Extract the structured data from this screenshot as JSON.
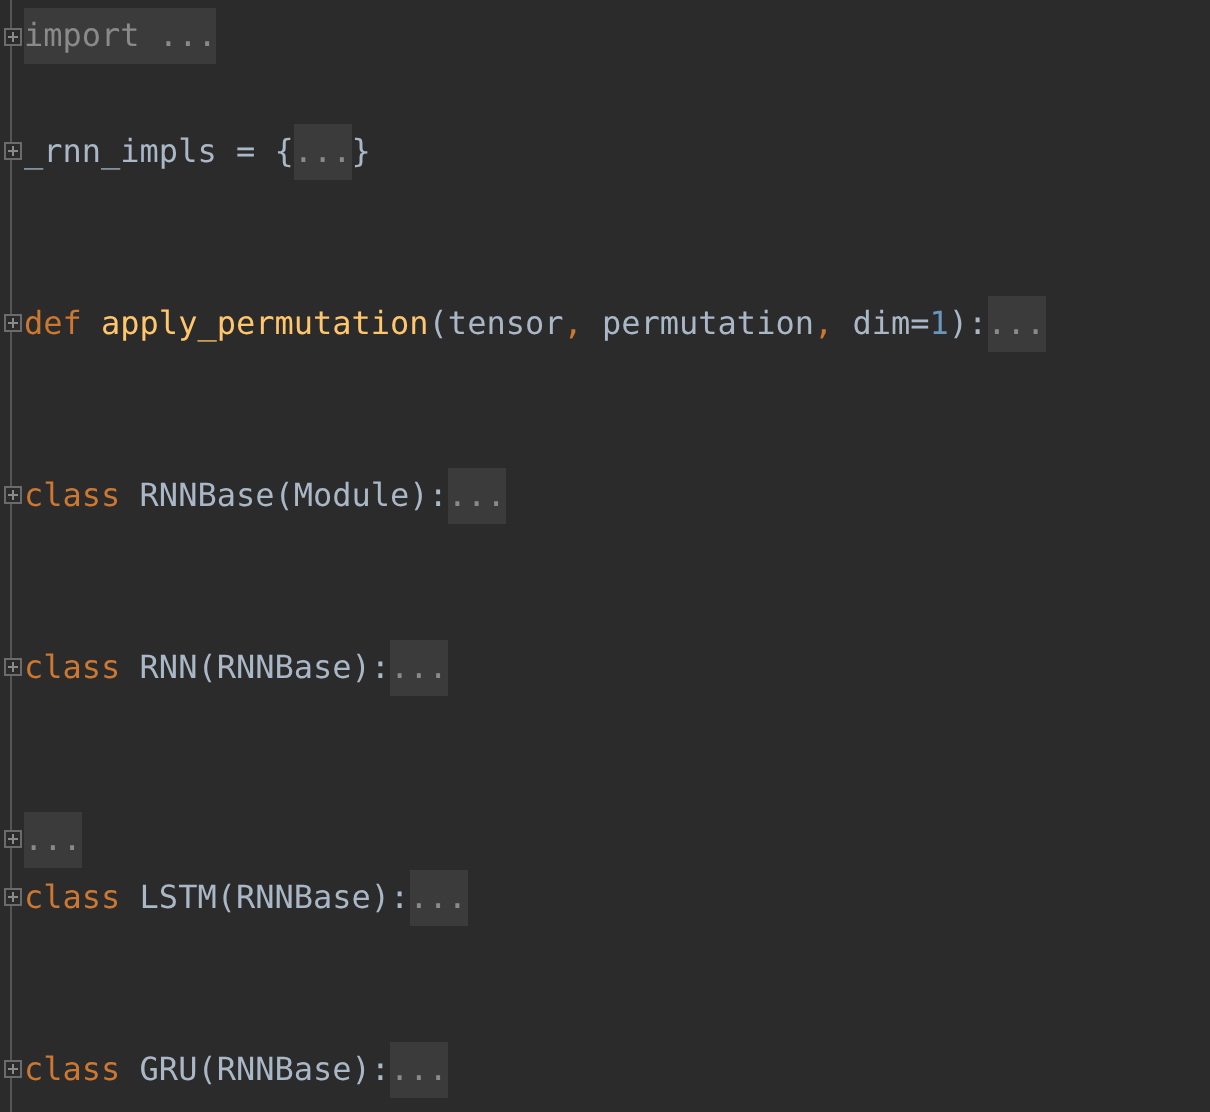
{
  "editor": {
    "lines": [
      {
        "kind": "code",
        "foldable": true,
        "tokens": [
          {
            "kind": "folded",
            "text": "import ..."
          }
        ]
      },
      {
        "kind": "blank"
      },
      {
        "kind": "code",
        "foldable": true,
        "tokens": [
          {
            "kind": "text",
            "text": "_rnn_impls = {"
          },
          {
            "kind": "folded",
            "text": "..."
          },
          {
            "kind": "text",
            "text": "}"
          }
        ]
      },
      {
        "kind": "blank"
      },
      {
        "kind": "blank"
      },
      {
        "kind": "code",
        "foldable": true,
        "tokens": [
          {
            "kind": "keyword",
            "text": "def "
          },
          {
            "kind": "function",
            "text": "apply_permutation"
          },
          {
            "kind": "text",
            "text": "(tensor"
          },
          {
            "kind": "punct",
            "text": ", "
          },
          {
            "kind": "text",
            "text": "permutation"
          },
          {
            "kind": "punct",
            "text": ", "
          },
          {
            "kind": "text",
            "text": "dim="
          },
          {
            "kind": "number",
            "text": "1"
          },
          {
            "kind": "text",
            "text": "):"
          },
          {
            "kind": "folded",
            "text": "..."
          }
        ]
      },
      {
        "kind": "blank"
      },
      {
        "kind": "blank"
      },
      {
        "kind": "code",
        "foldable": true,
        "tokens": [
          {
            "kind": "keyword",
            "text": "class "
          },
          {
            "kind": "text",
            "text": "RNNBase(Module):"
          },
          {
            "kind": "folded",
            "text": "..."
          }
        ]
      },
      {
        "kind": "blank"
      },
      {
        "kind": "blank"
      },
      {
        "kind": "code",
        "foldable": true,
        "tokens": [
          {
            "kind": "keyword",
            "text": "class "
          },
          {
            "kind": "text",
            "text": "RNN(RNNBase):"
          },
          {
            "kind": "folded",
            "text": "..."
          }
        ]
      },
      {
        "kind": "blank"
      },
      {
        "kind": "blank"
      },
      {
        "kind": "code",
        "foldable": true,
        "tokens": [
          {
            "kind": "folded",
            "text": "..."
          }
        ]
      },
      {
        "kind": "code",
        "foldable": true,
        "tokens": [
          {
            "kind": "keyword",
            "text": "class "
          },
          {
            "kind": "text",
            "text": "LSTM(RNNBase):"
          },
          {
            "kind": "folded",
            "text": "..."
          }
        ]
      },
      {
        "kind": "blank"
      },
      {
        "kind": "blank"
      },
      {
        "kind": "code",
        "foldable": true,
        "tokens": [
          {
            "kind": "keyword",
            "text": "class "
          },
          {
            "kind": "text",
            "text": "GRU(RNNBase):"
          },
          {
            "kind": "folded",
            "text": "..."
          }
        ]
      }
    ]
  }
}
